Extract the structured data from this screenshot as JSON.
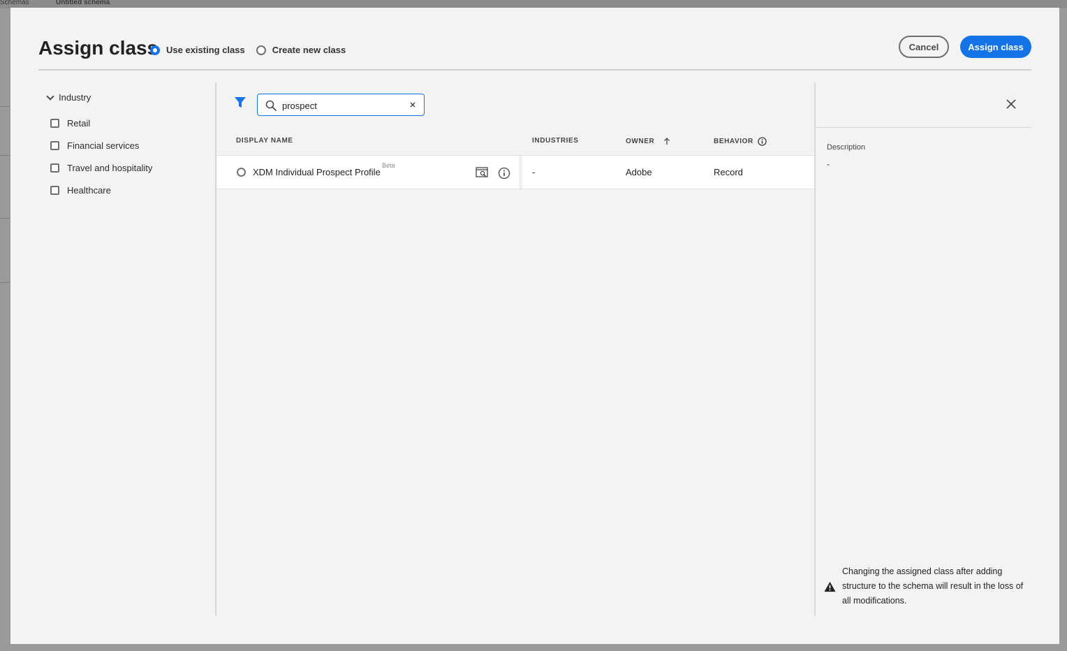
{
  "background": {
    "breadcrumb": [
      "Schemas",
      "Untitled schema"
    ]
  },
  "dialog": {
    "title": "Assign class",
    "mode_options": [
      {
        "label": "Use existing class",
        "selected": true
      },
      {
        "label": "Create new class",
        "selected": false
      }
    ],
    "cancel_label": "Cancel",
    "assign_label": "Assign class"
  },
  "filters": {
    "group_label": "Industry",
    "items": [
      {
        "label": "Retail",
        "checked": false
      },
      {
        "label": "Financial services",
        "checked": false
      },
      {
        "label": "Travel and hospitality",
        "checked": false
      },
      {
        "label": "Healthcare",
        "checked": false
      }
    ]
  },
  "search": {
    "value": "prospect"
  },
  "table": {
    "columns": {
      "display_name": "DISPLAY NAME",
      "industries": "INDUSTRIES",
      "owner": "OWNER",
      "behavior": "BEHAVIOR"
    },
    "sort": {
      "column": "owner",
      "direction": "ascending"
    },
    "rows": [
      {
        "display_name": "XDM Individual Prospect Profile",
        "badge": "Beta",
        "industries": "-",
        "owner": "Adobe",
        "behavior": "Record",
        "selected": false
      }
    ]
  },
  "details": {
    "description_label": "Description",
    "description_value": "-",
    "warning": "Changing the assigned class after adding structure to the schema will result in the loss of all modifications."
  },
  "colors": {
    "accent": "#1473e6",
    "dialog_bg": "#f3f3f3"
  }
}
